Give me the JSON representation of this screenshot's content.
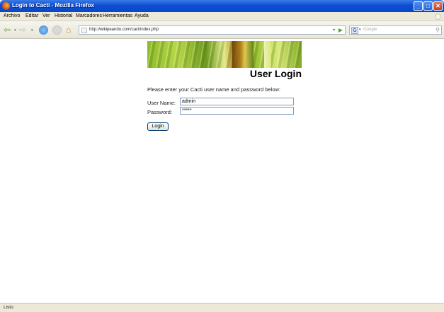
{
  "window": {
    "title": "Login to Cacti - Mozilla Firefox",
    "minimize_glyph": "_",
    "maximize_glyph": "□",
    "close_glyph": "✕"
  },
  "menu": {
    "items": [
      "Archivo",
      "Editar",
      "Ver",
      "Historial",
      "Marcadores",
      "Herramientas",
      "Ayuda"
    ]
  },
  "navigation": {
    "back_glyph": "⇦",
    "forward_glyph": "⇨",
    "home_glyph": "⌂",
    "dropdown_glyph": "▾",
    "go_glyph": "▶",
    "url": "http://wikipeando.com/caci/index.php",
    "search_engine_glyph": "G",
    "search_placeholder": "Google",
    "search_glyph": "⚲"
  },
  "login": {
    "heading": "User Login",
    "instructions": "Please enter your Cacti user name and password below:",
    "username_label": "User Name:",
    "username_value": "admin",
    "password_label": "Password:",
    "password_value": "*****",
    "submit_label": "Login"
  },
  "status": {
    "text": "Listo"
  }
}
